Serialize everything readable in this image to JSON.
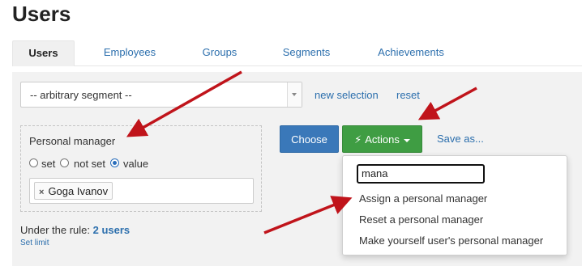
{
  "page": {
    "title": "Users"
  },
  "tabs": [
    {
      "label": "Users",
      "active": true
    },
    {
      "label": "Employees"
    },
    {
      "label": "Groups"
    },
    {
      "label": "Segments"
    },
    {
      "label": "Achievements"
    }
  ],
  "segment": {
    "selected": "-- arbitrary segment --",
    "new_selection": "new selection",
    "reset": "reset"
  },
  "filter": {
    "label": "Personal manager",
    "options": [
      "set",
      "not set",
      "value"
    ],
    "selected_option": "value",
    "tags": [
      "Goga Ivanov"
    ]
  },
  "rule": {
    "prefix": "Under the rule:",
    "count": "2 users",
    "set_limit": "Set limit"
  },
  "buttons": {
    "choose": "Choose",
    "actions": "Actions",
    "save_as": "Save as..."
  },
  "actions_menu": {
    "search_value": "mana",
    "items": [
      "Assign a personal manager",
      "Reset a personal manager",
      "Make yourself user's personal manager"
    ]
  },
  "colors": {
    "link": "#2c6fad",
    "choose_button": "#3a78b9",
    "actions_button": "#3f9d43",
    "annotation_arrow": "#c0141b"
  },
  "icons": {
    "remove_tag": "×",
    "actions_icon": "bolt-icon"
  }
}
